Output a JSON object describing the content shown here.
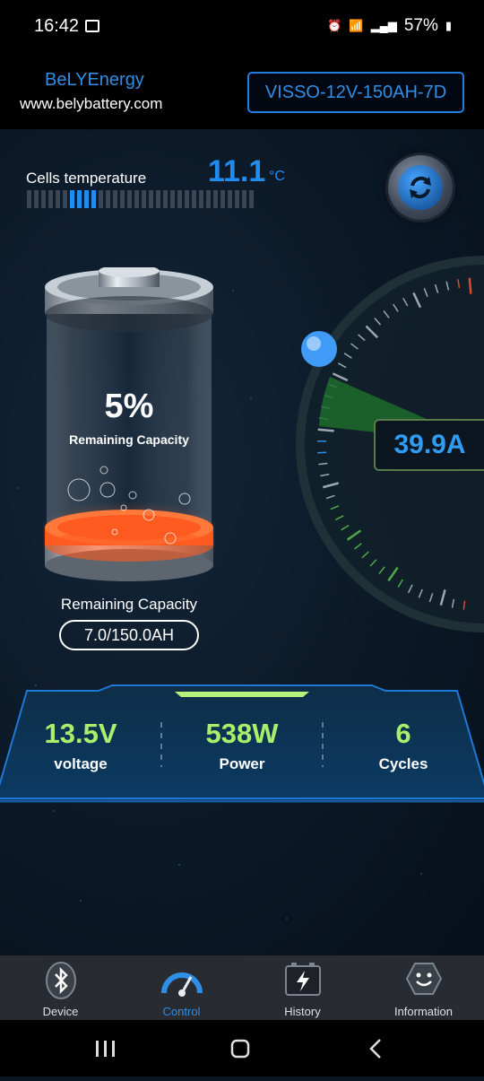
{
  "status_bar": {
    "time": "16:42",
    "battery": "57%"
  },
  "header": {
    "brand": "BeLYEnergy",
    "website": "www.belybattery.com",
    "model": "VISSO-12V-150AH-7D"
  },
  "temperature": {
    "label": "Cells temperature",
    "value": "11.1",
    "unit": "°C",
    "level_fraction": 0.3
  },
  "battery": {
    "percent": "5%",
    "subtitle": "Remaining Capacity",
    "level_fraction": 0.05
  },
  "capacity": {
    "label": "Remaining Capacity",
    "value": "7.0/150.0AH"
  },
  "current": {
    "value": "39.9A"
  },
  "stats": [
    {
      "value": "13.5V",
      "label": "voltage"
    },
    {
      "value": "538W",
      "label": "Power"
    },
    {
      "value": "6",
      "label": "Cycles"
    }
  ],
  "nav": [
    {
      "label": "Device",
      "icon": "bluetooth-icon"
    },
    {
      "label": "Control",
      "icon": "speedometer-icon",
      "active": true
    },
    {
      "label": "History",
      "icon": "battery-flash-icon"
    },
    {
      "label": "Information",
      "icon": "smiley-icon"
    }
  ],
  "colors": {
    "accent": "#2f8ee6",
    "stat_green": "#a8f06a",
    "gauge_green": "#1f6b2a",
    "charge_orange": "#ff5a1f"
  }
}
